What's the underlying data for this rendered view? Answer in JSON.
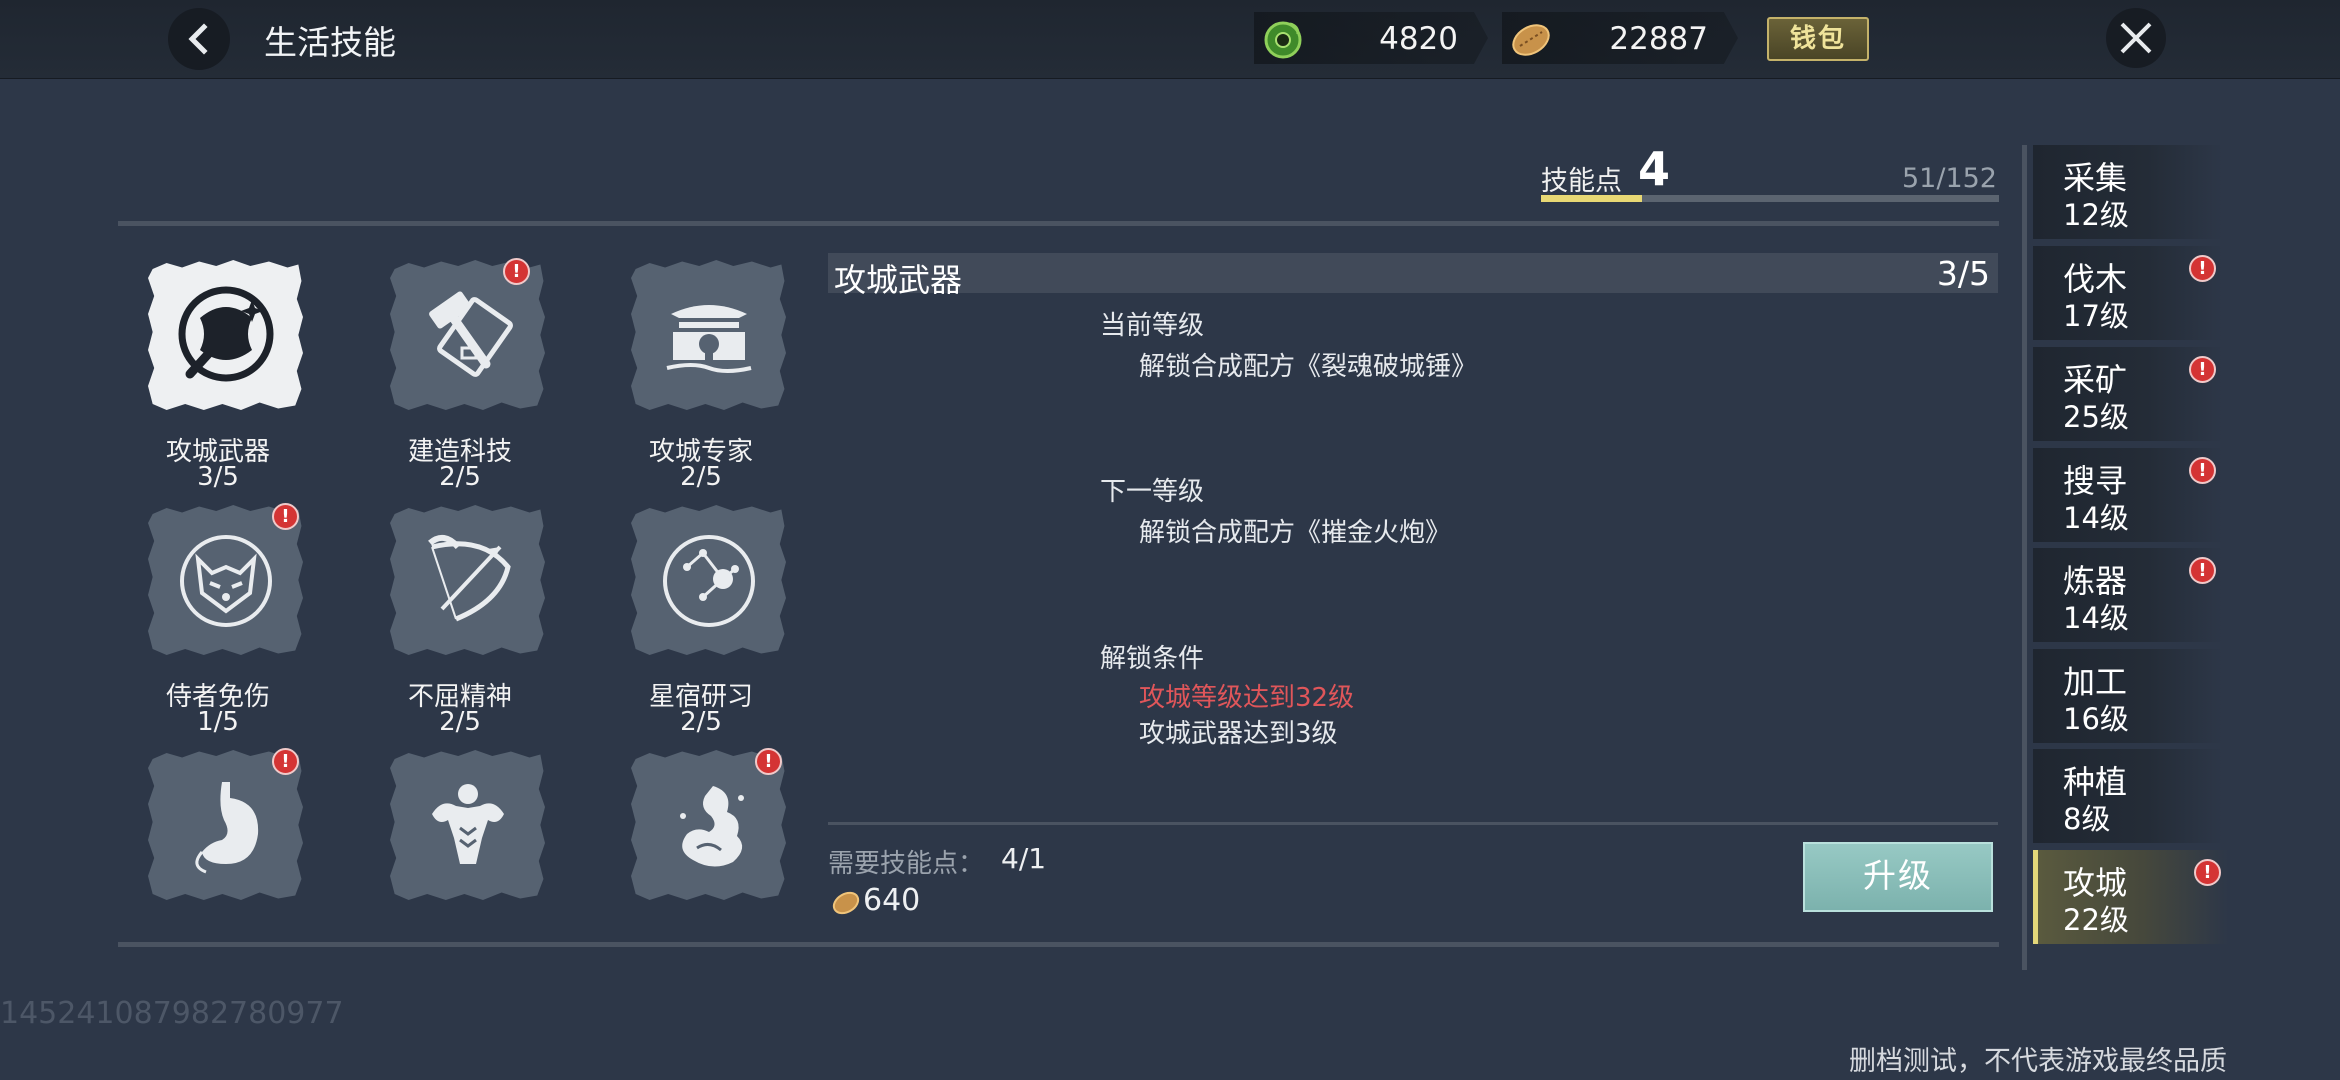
{
  "header": {
    "title": "生活技能",
    "currencies": [
      {
        "name": "jade-coin-icon",
        "value": "4820"
      },
      {
        "name": "gold-ingot-icon",
        "value": "22887"
      }
    ],
    "wallet_label": "钱包"
  },
  "skill_points": {
    "label": "技能点",
    "value": "4",
    "total": "51/152",
    "progress_fraction": 0.22
  },
  "skills": [
    {
      "name": "攻城武器",
      "level": "3/5",
      "icon": "battle-axe-icon",
      "alert": false,
      "active": true
    },
    {
      "name": "建造科技",
      "level": "2/5",
      "icon": "hammer-blueprint-icon",
      "alert": true,
      "active": false
    },
    {
      "name": "攻城专家",
      "level": "2/5",
      "icon": "gate-tower-icon",
      "alert": false,
      "active": false
    },
    {
      "name": "侍者免伤",
      "level": "1/5",
      "icon": "fox-mask-icon",
      "alert": true,
      "active": false
    },
    {
      "name": "不屈精神",
      "level": "2/5",
      "icon": "bow-arrow-icon",
      "alert": false,
      "active": false
    },
    {
      "name": "星宿研习",
      "level": "2/5",
      "icon": "constellation-icon",
      "alert": false,
      "active": false
    },
    {
      "name": "",
      "level": "",
      "icon": "stomach-icon",
      "alert": true,
      "active": false
    },
    {
      "name": "",
      "level": "",
      "icon": "muscle-body-icon",
      "alert": false,
      "active": false
    },
    {
      "name": "",
      "level": "",
      "icon": "dragon-cloud-icon",
      "alert": true,
      "active": false
    }
  ],
  "detail": {
    "title": "攻城武器",
    "level": "3/5",
    "current_label": "当前等级",
    "current_effect": "解锁合成配方《裂魂破城锤》",
    "next_label": "下一等级",
    "next_effect": "解锁合成配方《摧金火炮》",
    "unlock_label": "解锁条件",
    "unlock_conditions": [
      {
        "text": "攻城等级达到32级",
        "met": false
      },
      {
        "text": "攻城武器达到3级",
        "met": true
      }
    ],
    "cost_label": "需要技能点：",
    "cost_value": "4/1",
    "gold_cost": "640",
    "upgrade_label": "升级"
  },
  "categories": [
    {
      "name": "采集",
      "level": "12级",
      "alert": false,
      "selected": false
    },
    {
      "name": "伐木",
      "level": "17级",
      "alert": true,
      "selected": false
    },
    {
      "name": "采矿",
      "level": "25级",
      "alert": true,
      "selected": false
    },
    {
      "name": "搜寻",
      "level": "14级",
      "alert": true,
      "selected": false
    },
    {
      "name": "炼器",
      "level": "14级",
      "alert": true,
      "selected": false
    },
    {
      "name": "加工",
      "level": "16级",
      "alert": false,
      "selected": false
    },
    {
      "name": "种植",
      "level": "8级",
      "alert": false,
      "selected": false
    },
    {
      "name": "攻城",
      "level": "22级",
      "alert": true,
      "selected": true
    }
  ],
  "footer": {
    "player_id": "14524108798278097​7",
    "disclaimer": "删档测试，不代表游戏最终品质"
  },
  "colors": {
    "background": "#2d3748",
    "accent_gold": "#e8d874",
    "alert_red": "#d43434",
    "unmet_condition": "#e0565a",
    "upgrade_button": "#8cc1bc"
  }
}
